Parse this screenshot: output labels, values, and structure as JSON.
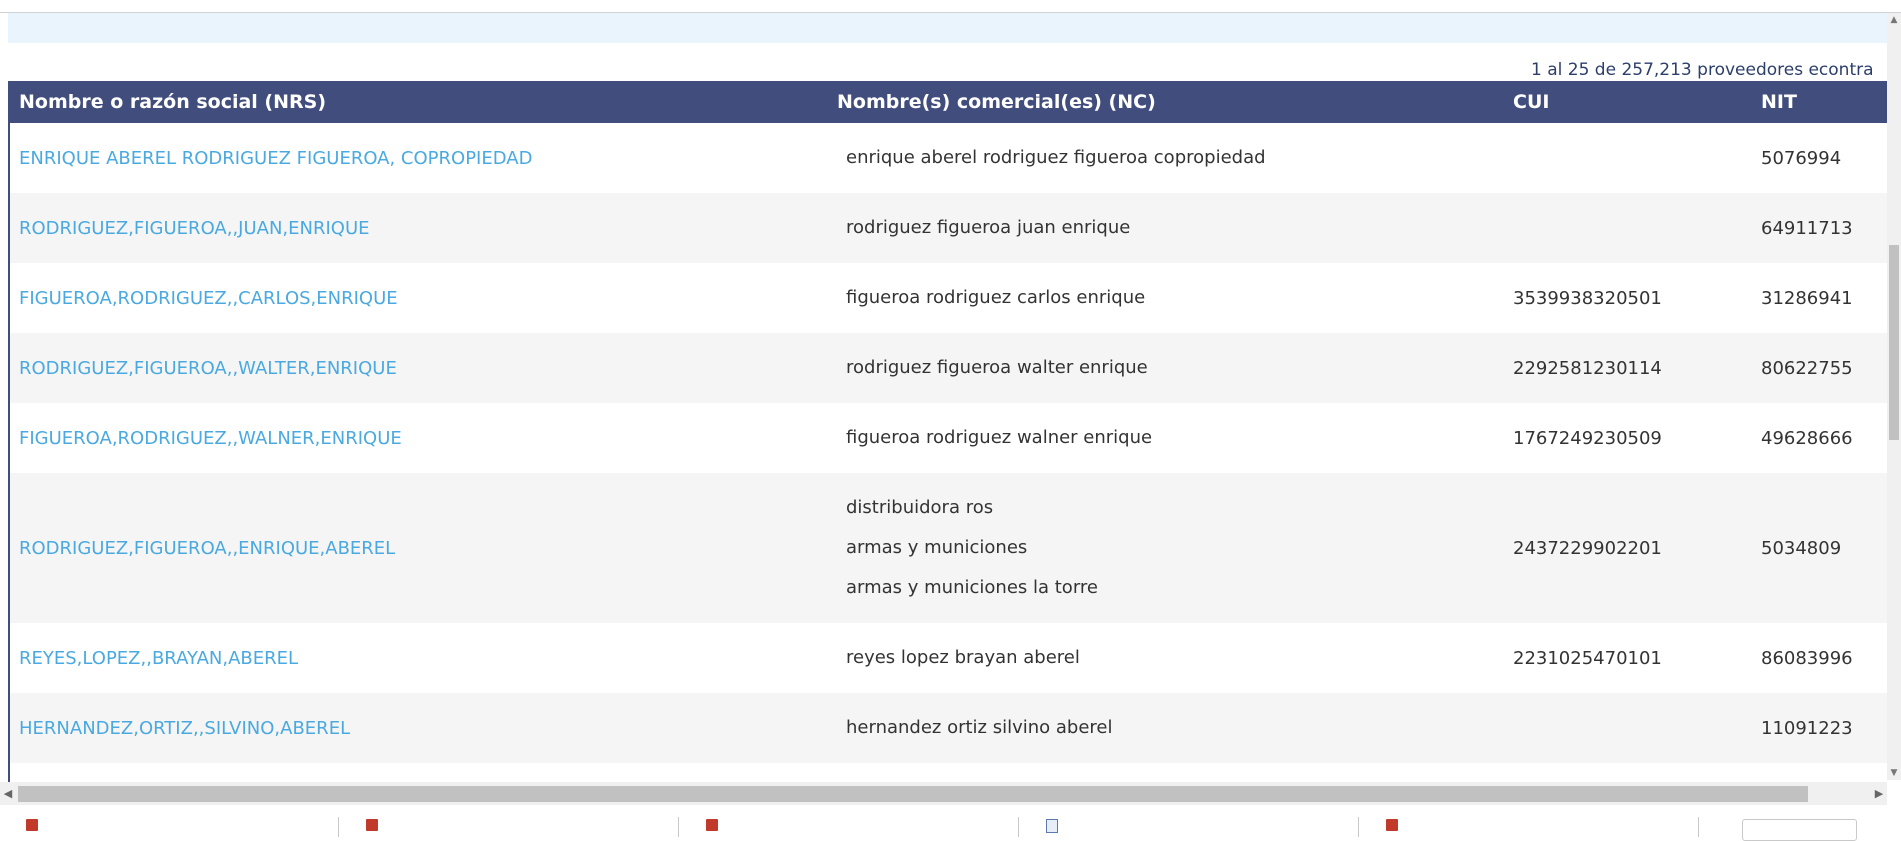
{
  "results_count": "1 al 25 de 257,213 proveedores econtra",
  "columns": [
    "Nombre o razón social (NRS)",
    "Nombre(s) comercial(es) (NC)",
    "CUI",
    "NIT"
  ],
  "rows": [
    {
      "nrs": "ENRIQUE ABEREL RODRIGUEZ FIGUEROA, COPROPIEDAD",
      "nc": [
        "enrique aberel rodriguez figueroa copropiedad"
      ],
      "cui": "",
      "nit": "5076994"
    },
    {
      "nrs": "RODRIGUEZ,FIGUEROA,,JUAN,ENRIQUE",
      "nc": [
        "rodriguez figueroa juan enrique"
      ],
      "cui": "",
      "nit": "64911713"
    },
    {
      "nrs": "FIGUEROA,RODRIGUEZ,,CARLOS,ENRIQUE",
      "nc": [
        "figueroa rodriguez carlos enrique"
      ],
      "cui": "3539938320501",
      "nit": "31286941"
    },
    {
      "nrs": "RODRIGUEZ,FIGUEROA,,WALTER,ENRIQUE",
      "nc": [
        "rodriguez figueroa walter enrique"
      ],
      "cui": "2292581230114",
      "nit": "80622755"
    },
    {
      "nrs": "FIGUEROA,RODRIGUEZ,,WALNER,ENRIQUE",
      "nc": [
        "figueroa rodriguez walner enrique"
      ],
      "cui": "1767249230509",
      "nit": "49628666"
    },
    {
      "nrs": "RODRIGUEZ,FIGUEROA,,ENRIQUE,ABEREL",
      "nc": [
        "distribuidora ros",
        "armas y municiones",
        "armas y municiones la torre"
      ],
      "cui": "2437229902201",
      "nit": "5034809"
    },
    {
      "nrs": "REYES,LOPEZ,,BRAYAN,ABEREL",
      "nc": [
        "reyes lopez brayan aberel"
      ],
      "cui": "2231025470101",
      "nit": "86083996"
    },
    {
      "nrs": "HERNANDEZ,ORTIZ,,SILVINO,ABEREL",
      "nc": [
        "hernandez ortiz silvino aberel"
      ],
      "cui": "",
      "nit": "11091223"
    }
  ],
  "colors": {
    "header_bg": "#414e7d",
    "link": "#4aa9e0",
    "banner": "#eaf4fd"
  },
  "icons": {
    "scroll_up": "chevron-up-icon",
    "scroll_down": "chevron-down-icon",
    "scroll_left": "chevron-left-icon",
    "scroll_right": "chevron-right-icon"
  }
}
